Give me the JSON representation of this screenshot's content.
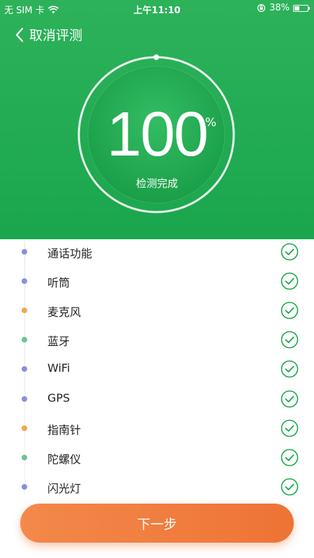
{
  "status_bar": {
    "carrier": "无 SIM 卡",
    "time": "上午11:10",
    "battery_text": "38%",
    "battery_level": 0.38,
    "icons": [
      "wifi-icon",
      "orientation-lock-icon",
      "battery-icon"
    ]
  },
  "nav": {
    "back_label": "取消评测",
    "icon": "chevron-left-icon"
  },
  "gauge": {
    "value": "100",
    "unit": "%",
    "caption": "检测完成",
    "progress": 1.0
  },
  "checklist": {
    "items": [
      {
        "label": "通话功能",
        "dot_color": "#8b8fe0",
        "status": "done"
      },
      {
        "label": "听筒",
        "dot_color": "#8b8fe0",
        "status": "done"
      },
      {
        "label": "麦克风",
        "dot_color": "#f3a54f",
        "status": "done"
      },
      {
        "label": "蓝牙",
        "dot_color": "#6bc492",
        "status": "done"
      },
      {
        "label": "WiFi",
        "dot_color": "#8b8fe0",
        "status": "done"
      },
      {
        "label": "GPS",
        "dot_color": "#8b8fe0",
        "status": "done"
      },
      {
        "label": "指南针",
        "dot_color": "#f3a54f",
        "status": "done"
      },
      {
        "label": "陀螺仪",
        "dot_color": "#6bc492",
        "status": "done"
      },
      {
        "label": "闪光灯",
        "dot_color": "#8b8fe0",
        "status": "done"
      }
    ],
    "check_icon": "check-circle-icon",
    "check_color": "#1aa64d"
  },
  "footer": {
    "next_label": "下一步"
  },
  "colors": {
    "primary_green": "#1aa64d",
    "accent_orange": "#ee7335"
  }
}
